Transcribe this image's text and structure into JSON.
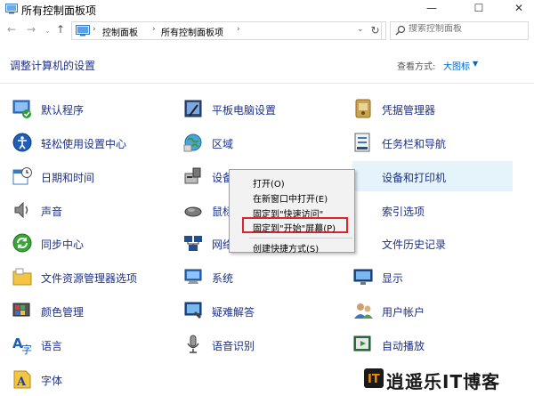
{
  "window": {
    "title": "所有控制面板项",
    "minimize": "—",
    "maximize": "☐",
    "close": "✕"
  },
  "nav": {
    "back": "←",
    "forward": "→",
    "recent": "⌄",
    "up": "↑",
    "breadcrumb": [
      "控制面板",
      "所有控制面板项"
    ],
    "refresh": "↻",
    "search_placeholder": "搜索控制面板"
  },
  "header": {
    "heading": "调整计算机的设置",
    "view_by_label": "查看方式:",
    "view_by_value": "大图标"
  },
  "items": [
    {
      "label": "默认程序",
      "icon": "default-programs-icon"
    },
    {
      "label": "平板电脑设置",
      "icon": "tablet-settings-icon"
    },
    {
      "label": "凭据管理器",
      "icon": "credential-manager-icon"
    },
    {
      "label": "轻松使用设置中心",
      "icon": "ease-of-access-icon"
    },
    {
      "label": "区域",
      "icon": "region-icon"
    },
    {
      "label": "任务栏和导航",
      "icon": "taskbar-icon"
    },
    {
      "label": "日期和时间",
      "icon": "date-time-icon"
    },
    {
      "label": "设备",
      "icon": "device-manager-icon"
    },
    {
      "label": "设备和打印机",
      "icon": "devices-printers-icon"
    },
    {
      "label": "声音",
      "icon": "sound-icon"
    },
    {
      "label": "鼠标",
      "icon": "mouse-icon"
    },
    {
      "label": "索引选项",
      "icon": "indexing-options-icon"
    },
    {
      "label": "同步中心",
      "icon": "sync-center-icon"
    },
    {
      "label": "网络",
      "icon": "network-icon"
    },
    {
      "label": "文件历史记录",
      "icon": "file-history-icon"
    },
    {
      "label": "文件资源管理器选项",
      "icon": "file-explorer-options-icon"
    },
    {
      "label": "系统",
      "icon": "system-icon"
    },
    {
      "label": "显示",
      "icon": "display-icon"
    },
    {
      "label": "颜色管理",
      "icon": "color-management-icon"
    },
    {
      "label": "疑难解答",
      "icon": "troubleshooting-icon"
    },
    {
      "label": "用户帐户",
      "icon": "user-accounts-icon"
    },
    {
      "label": "语言",
      "icon": "language-icon"
    },
    {
      "label": "语音识别",
      "icon": "speech-recognition-icon"
    },
    {
      "label": "自动播放",
      "icon": "autoplay-icon"
    },
    {
      "label": "字体",
      "icon": "fonts-icon"
    }
  ],
  "context_menu": {
    "items": [
      "打开(O)",
      "在新窗口中打开(E)",
      "固定到\"快速访问\"",
      "固定到\"开始\"屏幕(P)",
      "创建快捷方式(S)"
    ],
    "highlighted_index": 3,
    "highlight_color": "#e0222a"
  },
  "watermark": {
    "text": "逍遥乐IT博客",
    "accent": "#f08c00"
  },
  "colors": {
    "link": "#1e3287",
    "hover": "#e5f3fb"
  }
}
